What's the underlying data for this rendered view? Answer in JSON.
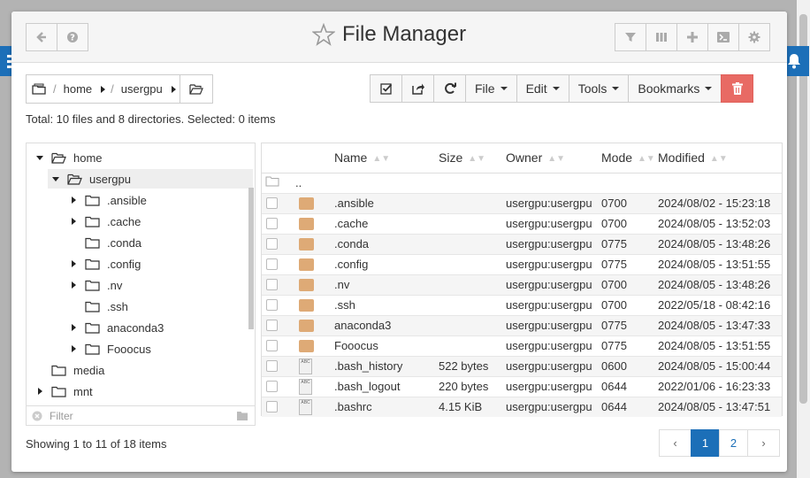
{
  "header": {
    "title": "File Manager",
    "left_buttons": [
      "arrow-left-icon",
      "question-icon"
    ],
    "right_buttons": [
      "filter-icon",
      "columns-icon",
      "plus-icon",
      "terminal-icon",
      "gear-icon"
    ]
  },
  "breadcrumb": [
    "home",
    "usergpu"
  ],
  "toolbar": {
    "file": "File",
    "edit": "Edit",
    "tools": "Tools",
    "bookmarks": "Bookmarks"
  },
  "total": "Total: 10 files and 8 directories. Selected: 0 items",
  "tree": {
    "items": [
      {
        "label": "home",
        "expanded": true
      },
      {
        "label": "usergpu",
        "expanded": true
      },
      {
        "label": ".ansible",
        "expandable": true
      },
      {
        "label": ".cache",
        "expandable": true
      },
      {
        "label": ".conda",
        "expandable": false
      },
      {
        "label": ".config",
        "expandable": true
      },
      {
        "label": ".nv",
        "expandable": true
      },
      {
        "label": ".ssh",
        "expandable": false
      },
      {
        "label": "anaconda3",
        "expandable": true
      },
      {
        "label": "Fooocus",
        "expandable": true
      },
      {
        "label": "media",
        "expandable": false
      },
      {
        "label": "mnt",
        "expandable": true
      }
    ],
    "filter_placeholder": "Filter"
  },
  "table": {
    "columns": [
      "Name",
      "Size",
      "Owner",
      "Mode",
      "Modified"
    ],
    "parent": "..",
    "rows": [
      {
        "type": "folder",
        "name": ".ansible",
        "size": "",
        "owner": "usergpu:usergpu",
        "mode": "0700",
        "modified": "2024/08/02 - 15:23:18"
      },
      {
        "type": "folder",
        "name": ".cache",
        "size": "",
        "owner": "usergpu:usergpu",
        "mode": "0700",
        "modified": "2024/08/05 - 13:52:03"
      },
      {
        "type": "folder",
        "name": ".conda",
        "size": "",
        "owner": "usergpu:usergpu",
        "mode": "0775",
        "modified": "2024/08/05 - 13:48:26"
      },
      {
        "type": "folder",
        "name": ".config",
        "size": "",
        "owner": "usergpu:usergpu",
        "mode": "0775",
        "modified": "2024/08/05 - 13:51:55"
      },
      {
        "type": "folder",
        "name": ".nv",
        "size": "",
        "owner": "usergpu:usergpu",
        "mode": "0700",
        "modified": "2024/08/05 - 13:48:26"
      },
      {
        "type": "folder",
        "name": ".ssh",
        "size": "",
        "owner": "usergpu:usergpu",
        "mode": "0700",
        "modified": "2022/05/18 - 08:42:16"
      },
      {
        "type": "folder",
        "name": "anaconda3",
        "size": "",
        "owner": "usergpu:usergpu",
        "mode": "0775",
        "modified": "2024/08/05 - 13:47:33"
      },
      {
        "type": "folder",
        "name": "Fooocus",
        "size": "",
        "owner": "usergpu:usergpu",
        "mode": "0775",
        "modified": "2024/08/05 - 13:51:55"
      },
      {
        "type": "file",
        "name": ".bash_history",
        "size": "522 bytes",
        "owner": "usergpu:usergpu",
        "mode": "0600",
        "modified": "2024/08/05 - 15:00:44"
      },
      {
        "type": "file",
        "name": ".bash_logout",
        "size": "220 bytes",
        "owner": "usergpu:usergpu",
        "mode": "0644",
        "modified": "2022/01/06 - 16:23:33"
      },
      {
        "type": "file",
        "name": ".bashrc",
        "size": "4.15 KiB",
        "owner": "usergpu:usergpu",
        "mode": "0644",
        "modified": "2024/08/05 - 13:47:51"
      }
    ]
  },
  "pagination": {
    "showing": "Showing 1 to 11 of 18 items",
    "prev": "‹",
    "pages": [
      "1",
      "2"
    ],
    "active": "1",
    "next": "›"
  },
  "colors": {
    "accent": "#1c6fb8",
    "danger": "#e86a64",
    "folder": "#deaa76"
  }
}
